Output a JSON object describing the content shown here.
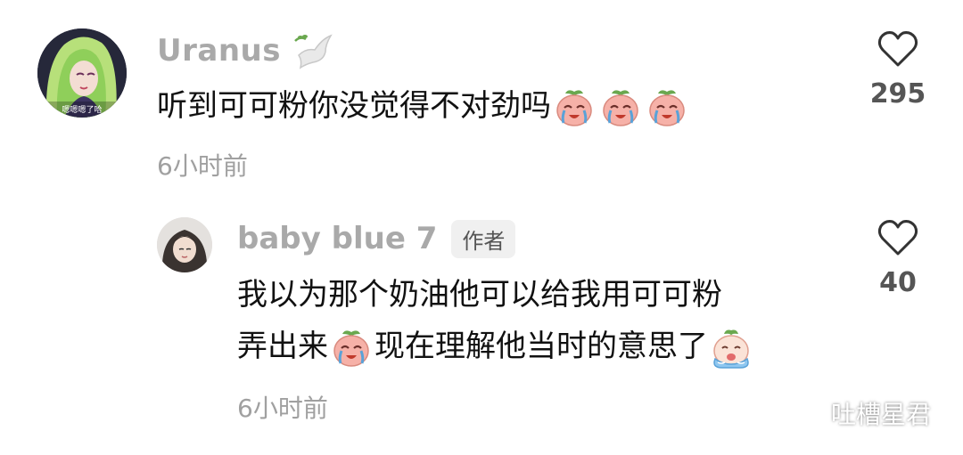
{
  "comment": {
    "username": "Uranus",
    "text": "听到可可粉你没觉得不对劲吗",
    "time": "6小时前",
    "likes": "295",
    "emoji_count": 3,
    "avatar_text": "嗯嗯嗯了哈"
  },
  "reply": {
    "username": "baby blue 7",
    "badge": "作者",
    "line1": "我以为那个奶油他可以给我用可可粉",
    "line2_before": "弄出来",
    "line2_after": "现在理解他当时的意思了",
    "time": "6小时前",
    "likes": "40"
  },
  "watermark": {
    "text": "吐槽星君",
    "icon": "wechat-icon"
  },
  "icons": {
    "like": "heart-outline-icon",
    "username_decor": "dove-icon",
    "emoji_main": "crying-peach-emoji",
    "emoji_end": "crying-blue-emoji"
  },
  "colors": {
    "username": "#a9a9a9",
    "text": "#111111",
    "meta": "#a0a0a0",
    "likes": "#555555",
    "emoji_face": "#f6b1a8"
  }
}
